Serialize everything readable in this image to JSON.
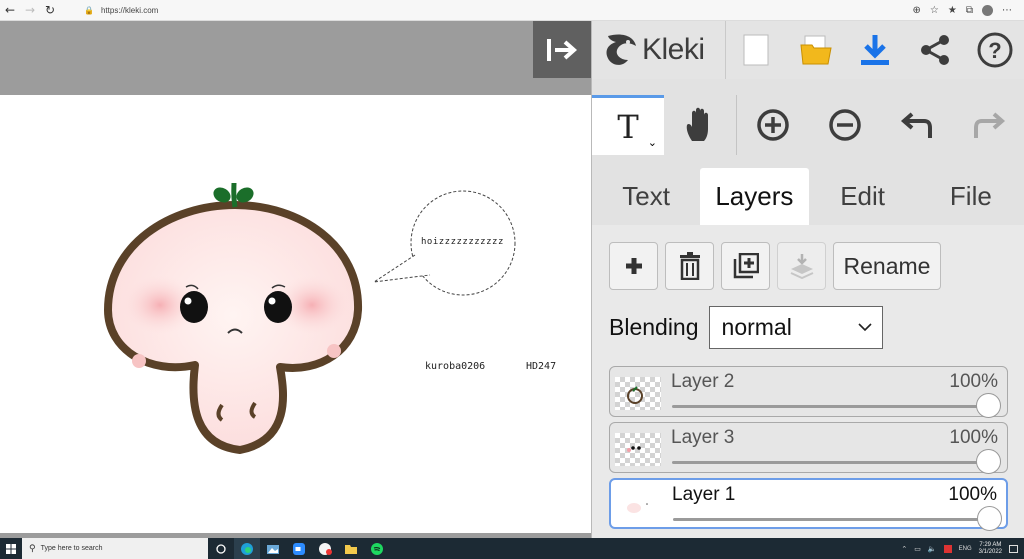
{
  "browser": {
    "url": "https://kleki.com"
  },
  "canvas": {
    "speech_text": "hoizzzzzzzzzzz",
    "signature_text": "kuroba0206",
    "tag_text": "HD247"
  },
  "app": {
    "logo": "Kleki"
  },
  "tools": {
    "active_tool_glyph": "T",
    "chevron": "⌄"
  },
  "tabs": [
    {
      "label": "Text"
    },
    {
      "label": "Layers"
    },
    {
      "label": "Edit"
    },
    {
      "label": "File"
    }
  ],
  "layers_panel": {
    "rename_label": "Rename",
    "blending_label": "Blending",
    "blending_value": "normal",
    "layers": [
      {
        "name": "Layer 2",
        "opacity": "100%"
      },
      {
        "name": "Layer 3",
        "opacity": "100%"
      },
      {
        "name": "Layer 1",
        "opacity": "100%"
      }
    ]
  },
  "taskbar": {
    "search_placeholder": "Type here to search",
    "language": "ENG",
    "time": "7:29 AM",
    "date": "3/1/2022"
  },
  "colors": {
    "accent": "#1a73e8",
    "selected_border": "#6d9de8",
    "outline_brown": "#5a4128",
    "sprout_green": "#1b6e2a"
  }
}
